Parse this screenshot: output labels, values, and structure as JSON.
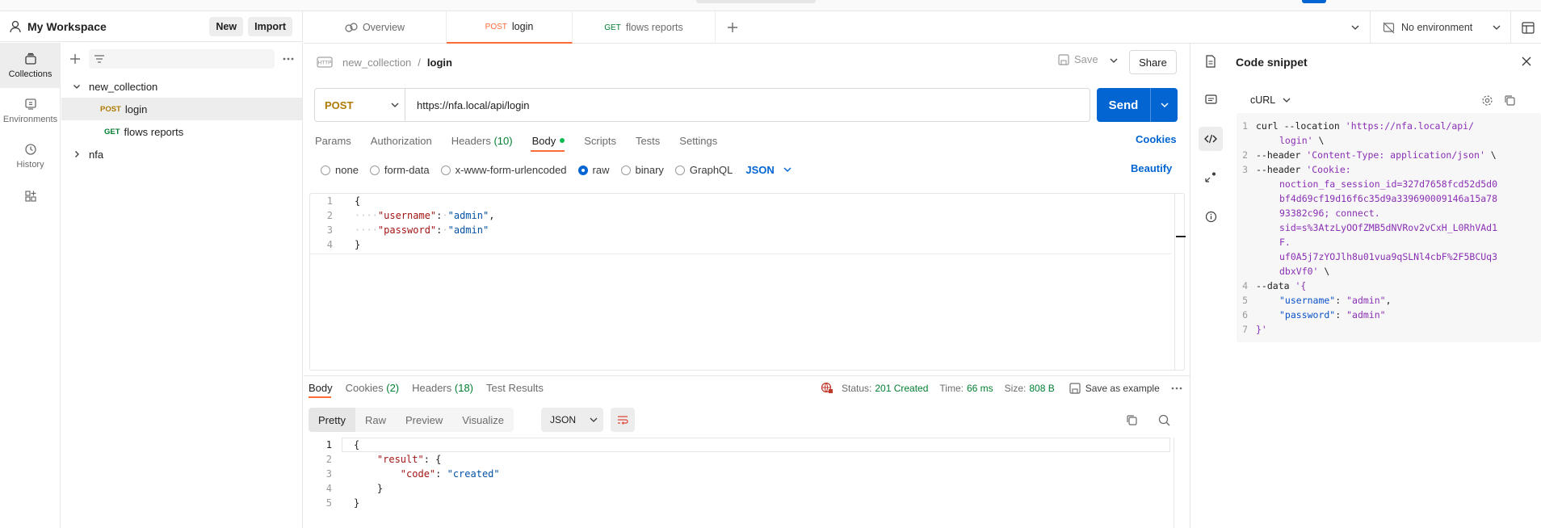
{
  "workspace": {
    "title": "My Workspace",
    "new_label": "New",
    "import_label": "Import"
  },
  "rail": [
    {
      "label": "Collections",
      "icon": "collections-icon"
    },
    {
      "label": "Environments",
      "icon": "environments-icon"
    },
    {
      "label": "History",
      "icon": "history-icon"
    },
    {
      "label": "",
      "icon": "add-apps-icon"
    }
  ],
  "sidebar": {
    "collection": "new_collection",
    "requests": [
      {
        "method": "POST",
        "name": "login"
      },
      {
        "method": "GET",
        "name": "flows reports"
      }
    ],
    "folder": "nfa"
  },
  "tabs": [
    {
      "label": "Overview",
      "method": ""
    },
    {
      "label": "login",
      "method": "POST"
    },
    {
      "label": "flows reports",
      "method": "GET"
    }
  ],
  "environment": {
    "label": "No environment"
  },
  "request": {
    "breadcrumb_parent": "new_collection",
    "breadcrumb_sep": "/",
    "name": "login",
    "save_label": "Save",
    "share_label": "Share",
    "method": "POST",
    "url": "https://nfa.local/api/login",
    "send_label": "Send",
    "subtabs": [
      "Params",
      "Authorization",
      "Headers",
      "Body",
      "Scripts",
      "Tests",
      "Settings"
    ],
    "headers_count": "(10)",
    "cookies_label": "Cookies",
    "body_types": [
      "none",
      "form-data",
      "x-www-form-urlencoded",
      "raw",
      "binary",
      "GraphQL"
    ],
    "body_format": "JSON",
    "beautify_label": "Beautify",
    "body_lines": [
      {
        "n": "1",
        "open": "{"
      },
      {
        "n": "2",
        "key": "\"username\"",
        "val": "\"admin\"",
        "trail": ","
      },
      {
        "n": "3",
        "key": "\"password\"",
        "val": "\"admin\"",
        "trail": ""
      },
      {
        "n": "4",
        "open": "}"
      }
    ]
  },
  "response": {
    "tabs": {
      "body": "Body",
      "cookies": "Cookies",
      "cookies_count": "(2)",
      "headers": "Headers",
      "headers_count": "(18)",
      "results": "Test Results"
    },
    "status_label": "Status:",
    "status_value": "201 Created",
    "time_label": "Time:",
    "time_value": "66 ms",
    "size_label": "Size:",
    "size_value": "808 B",
    "save_example_label": "Save as example",
    "view_modes": [
      "Pretty",
      "Raw",
      "Preview",
      "Visualize"
    ],
    "format": "JSON",
    "lines": [
      {
        "n": "1",
        "text": "{"
      },
      {
        "n": "2",
        "key": "\"result\"",
        "text": ": {"
      },
      {
        "n": "3",
        "key": "\"code\"",
        "val": "\"created\""
      },
      {
        "n": "4",
        "text": "}"
      },
      {
        "n": "5",
        "text": "}"
      }
    ]
  },
  "snippet": {
    "title": "Code snippet",
    "language": "cURL",
    "l1a": "curl --location ",
    "l1b": "'https://nfa.local/api/",
    "l1c": "login'",
    "l1d": " \\",
    "l2a": "--header ",
    "l2b": "'Content-Type: application/json'",
    "l2c": " \\",
    "l3a": "--header ",
    "l3b": "'Cookie:",
    "l3c": "noction_fa_session_id=327d7658fcd52d5d0",
    "l3d": "bf4d69cf19d16f6c35d9a339690009146a15a78",
    "l3e": "93382c96; connect.",
    "l3f": "sid=s%3AtzLyOOfZMB5dNVRov2vCxH_L0RhVAd1",
    "l3g": "F.",
    "l3h": "uf0A5j7zYOJlh8u01vua9qSLNl4cbF%2F5BCUq3",
    "l3i": "dbxVf0'",
    "l3j": " \\",
    "l4a": "--data ",
    "l4b": "'{",
    "l5k": "\"username\"",
    "l5v": "\"admin\"",
    "l5c": ",",
    "l6k": "\"password\"",
    "l6v": "\"admin\"",
    "l7": "}'",
    "nums": [
      "1",
      "2",
      "3",
      "4",
      "5",
      "6",
      "7"
    ]
  },
  "colors": {
    "accent": "#ff6c37",
    "send": "#0265d2",
    "post": "#ad7a03",
    "get": "#007f31",
    "status_ok": "#007f31"
  }
}
